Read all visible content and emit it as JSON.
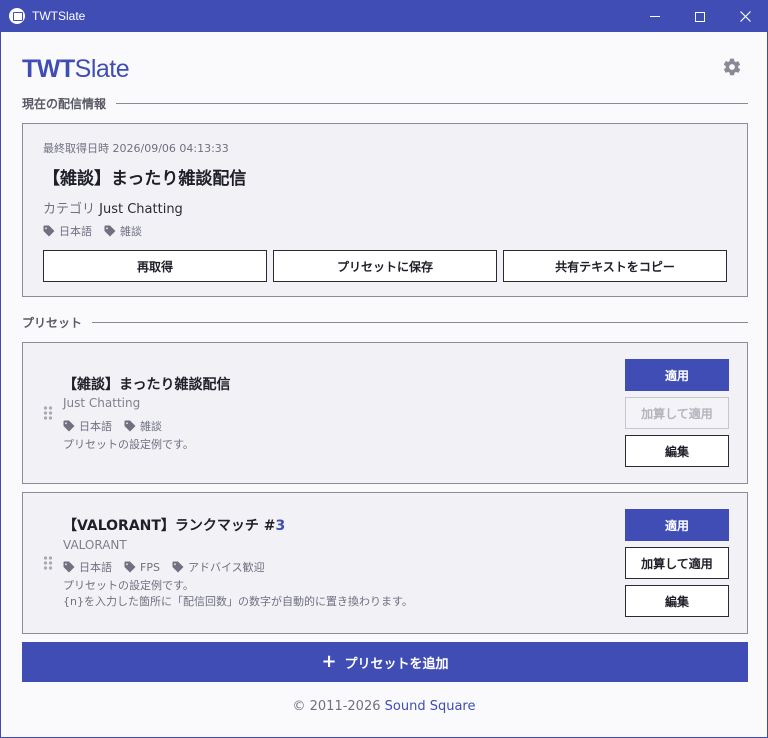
{
  "window": {
    "title": "TWTSlate",
    "controls": {
      "minimize": "minimize-icon",
      "maximize": "maximize-icon",
      "close": "close-icon"
    }
  },
  "header": {
    "logo_bold": "TWT",
    "logo_light": "Slate",
    "settings_icon": "gear-icon"
  },
  "current": {
    "section_label": "現在の配信情報",
    "last_fetched": "最終取得日時 2026/09/06 04:13:33",
    "title": "【雑談】まったり雑談配信",
    "category_label": "カテゴリ",
    "category_value": "Just Chatting",
    "tags": [
      "日本語",
      "雑談"
    ],
    "buttons": {
      "refetch": "再取得",
      "save_preset": "プリセットに保存",
      "copy_share": "共有テキストをコピー"
    }
  },
  "presets": {
    "section_label": "プリセット",
    "items": [
      {
        "title": "【雑談】まったり雑談配信",
        "category": "Just Chatting",
        "tags": [
          "日本語",
          "雑談"
        ],
        "description": "プリセットの設定例です。",
        "apply": "適用",
        "apply_incremented": "加算して適用",
        "edit": "編集"
      },
      {
        "title": "【VALORANT】ランクマッチ #",
        "title_number": "3",
        "category": "VALORANT",
        "tags": [
          "日本語",
          "FPS",
          "アドバイス歓迎"
        ],
        "description_line1": "プリセットの設定例です。",
        "description_line2": "{n}を入力した箇所に「配信回数」の数字が自動的に置き換わります。",
        "apply": "適用",
        "apply_incremented": "加算して適用",
        "edit": "編集"
      }
    ],
    "add_label": "プリセットを追加"
  },
  "footer": {
    "copyright": "© 2011-2026",
    "brand": "Sound Square"
  },
  "colors": {
    "accent": "#3f4db5",
    "background": "#fafafd",
    "card": "#f1f1f6"
  }
}
